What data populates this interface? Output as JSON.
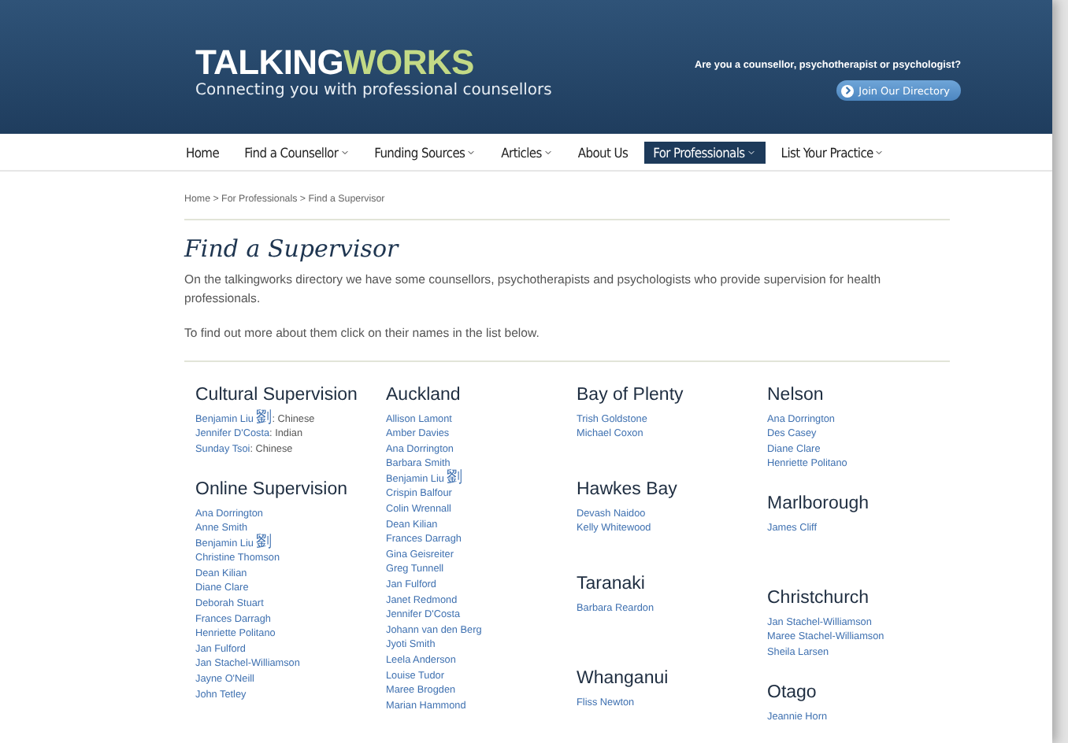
{
  "header": {
    "logo": {
      "part_1": "TALKING",
      "part_2": "WORKS"
    },
    "tagline": "Connecting you with professional counsellors",
    "prompt": "Are you a counsellor, psychotherapist or psychologist?",
    "join_button": "Join Our Directory"
  },
  "nav": [
    {
      "label": "Home",
      "dropdown": false,
      "selected": false
    },
    {
      "label": "Find a Counsellor",
      "dropdown": true,
      "selected": false
    },
    {
      "label": "Funding Sources",
      "dropdown": true,
      "selected": false
    },
    {
      "label": "Articles",
      "dropdown": true,
      "selected": false
    },
    {
      "label": "About Us",
      "dropdown": false,
      "selected": false
    },
    {
      "label": "For Professionals",
      "dropdown": true,
      "selected": true
    },
    {
      "label": "List Your Practice",
      "dropdown": true,
      "selected": false
    }
  ],
  "breadcrumb": "Home > For Professionals > Find a Supervisor",
  "title": "Find a Supervisor",
  "paragraphs": [
    "On the talkingworks directory we have some counsellors, psychotherapists and psychologists who provide supervision for health professionals.",
    "To find out more about them click on their names in the list below."
  ],
  "columns": [
    [
      {
        "heading": "Cultural Supervision",
        "people": [
          {
            "name": "Benjamin Liu",
            "native": "劉",
            "note": ": Chinese"
          },
          {
            "name": "Jennifer D'Costa",
            "note": ": Indian"
          },
          {
            "name": "Sunday Tsoi",
            "note": ": Chinese"
          }
        ]
      },
      {
        "heading": "Online Supervision",
        "people": [
          {
            "name": "Ana Dorrington"
          },
          {
            "name": "Anne Smith"
          },
          {
            "name": "Benjamin Liu",
            "native": "劉"
          },
          {
            "name": "Christine Thomson"
          },
          {
            "name": "Dean Kilian"
          },
          {
            "name": "Diane Clare"
          },
          {
            "name": "Deborah Stuart"
          },
          {
            "name": "Frances Darragh"
          },
          {
            "name": "Henriette Politano"
          },
          {
            "name": "Jan Fulford"
          },
          {
            "name": "Jan Stachel-Williamson"
          },
          {
            "name": "Jayne O'Neill"
          },
          {
            "name": "John Tetley"
          }
        ]
      }
    ],
    [
      {
        "heading": "Auckland",
        "people": [
          {
            "name": "Allison Lamont"
          },
          {
            "name": "Amber Davies"
          },
          {
            "name": "Ana Dorrington"
          },
          {
            "name": "Barbara Smith"
          },
          {
            "name": "Benjamin Liu",
            "native": "劉"
          },
          {
            "name": "Crispin Balfour"
          },
          {
            "name": "Colin Wrennall"
          },
          {
            "name": "Dean Kilian"
          },
          {
            "name": "Frances Darragh"
          },
          {
            "name": "Gina Geisreiter"
          },
          {
            "name": "Greg Tunnell"
          },
          {
            "name": "Jan Fulford"
          },
          {
            "name": "Janet Redmond"
          },
          {
            "name": "Jennifer D'Costa"
          },
          {
            "name": "Johann van den Berg"
          },
          {
            "name": "Jyoti Smith"
          },
          {
            "name": "Leela Anderson"
          },
          {
            "name": "Louise Tudor"
          },
          {
            "name": "Maree Brogden"
          },
          {
            "name": "Marian Hammond"
          }
        ]
      }
    ],
    [
      {
        "heading": "Bay of Plenty",
        "people": [
          {
            "name": "Trish Goldstone"
          },
          {
            "name": "Michael Coxon"
          }
        ]
      },
      {
        "heading": "Hawkes Bay",
        "people": [
          {
            "name": "Devash Naidoo"
          },
          {
            "name": "Kelly Whitewood"
          }
        ]
      },
      {
        "heading": "Taranaki",
        "people": [
          {
            "name": "Barbara Reardon"
          }
        ]
      },
      {
        "heading": "Whanganui",
        "people": [
          {
            "name": "Fliss Newton"
          }
        ]
      }
    ],
    [
      {
        "heading": "Nelson",
        "people": [
          {
            "name": "Ana Dorrington"
          },
          {
            "name": "Des Casey"
          },
          {
            "name": "Diane Clare"
          },
          {
            "name": "Henriette Politano"
          }
        ]
      },
      {
        "heading": "Marlborough",
        "people": [
          {
            "name": "James Cliff"
          }
        ]
      },
      {
        "heading": "Christchurch",
        "people": [
          {
            "name": "Jan Stachel-Williamson"
          },
          {
            "name": "Maree Stachel-Williamson"
          },
          {
            "name": "Sheila Larsen"
          }
        ]
      },
      {
        "heading": "Otago",
        "people": [
          {
            "name": "Jeannie Horn"
          }
        ]
      }
    ]
  ]
}
